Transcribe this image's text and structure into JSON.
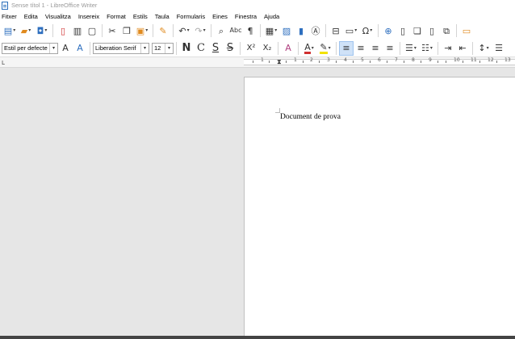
{
  "window": {
    "title": "Sense títol 1 - LibreOffice Writer"
  },
  "menu": [
    "Fitxer",
    "Edita",
    "Visualitza",
    "Insereix",
    "Format",
    "Estils",
    "Taula",
    "Formularis",
    "Eines",
    "Finestra",
    "Ajuda"
  ],
  "toolbar": {
    "paragraph_style": "Estil per defecte",
    "font_name": "Liberation Serif",
    "font_size": "12"
  },
  "icons": {
    "new": "new-document-icon",
    "open": "open-folder-icon",
    "save": "save-icon",
    "pdf": "export-pdf-icon",
    "print": "print-icon",
    "preview": "print-preview-icon",
    "cut": "cut-icon",
    "copy": "copy-icon",
    "paste": "paste-icon",
    "clone": "clone-formatting-icon",
    "undo": "undo-icon",
    "redo": "redo-icon",
    "find": "find-replace-icon",
    "spell": "spelling-icon",
    "formatting_marks": "pilcrow-icon",
    "table": "insert-table-icon",
    "image": "insert-image-icon",
    "chart": "insert-chart-icon",
    "textbox": "insert-textbox-icon",
    "page_break": "page-break-icon",
    "field": "insert-field-icon",
    "special_char": "omega-icon",
    "hyperlink": "hyperlink-icon",
    "footnote": "footnote-icon",
    "endnote": "endnote-icon",
    "bookmark": "bookmark-icon",
    "crossref": "cross-reference-icon",
    "comment": "comment-icon"
  },
  "format_labels": {
    "bold": "N",
    "italic": "C",
    "underline": "S",
    "strike": "S",
    "superscript": "X²",
    "subscript": "X₂"
  },
  "ruler": {
    "numbers": [
      "1",
      "1",
      "2",
      "3",
      "4",
      "5",
      "6",
      "7",
      "8",
      "9",
      "10",
      "11",
      "12",
      "13"
    ]
  },
  "document": {
    "text": "Document de prova"
  },
  "colors": {
    "accent": "#2e6fbf",
    "font_color": "#d03030",
    "highlight": "#f2e200"
  }
}
